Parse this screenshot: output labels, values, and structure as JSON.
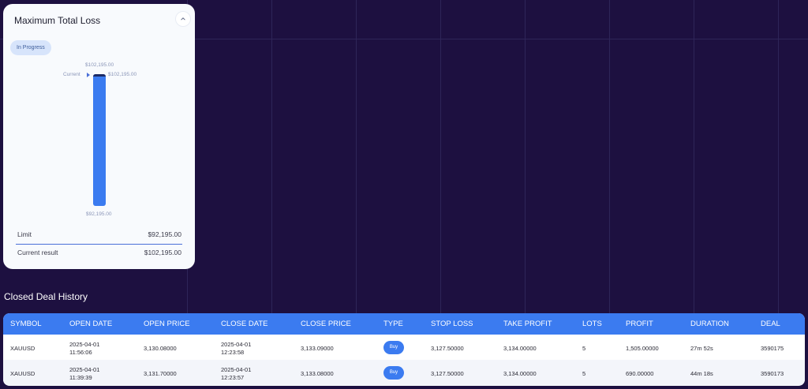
{
  "loss_card": {
    "title": "Maximum Total Loss",
    "status": "In Progress",
    "bar_top_value": "$102,195.00",
    "current_label": "Current",
    "current_value": "$102,195.00",
    "bar_bottom_value": "$92,195.00",
    "limit_label": "Limit",
    "limit_value": "$92,195.00",
    "current_result_label": "Current result",
    "current_result_value": "$102,195.00",
    "progress_fraction": 1.0
  },
  "history": {
    "title": "Closed Deal History",
    "columns": [
      "SYMBOL",
      "OPEN DATE",
      "OPEN PRICE",
      "CLOSE DATE",
      "CLOSE PRICE",
      "TYPE",
      "STOP LOSS",
      "TAKE PROFIT",
      "LOTS",
      "PROFIT",
      "DURATION",
      "DEAL"
    ],
    "rows": [
      {
        "symbol": "XAUUSD",
        "open_date": "2025-04-01",
        "open_time": "11:56:06",
        "open_price": "3,130.08000",
        "close_date": "2025-04-01",
        "close_time": "12:23:58",
        "close_price": "3,133.09000",
        "type": "Buy",
        "stop_loss": "3,127.50000",
        "take_profit": "3,134.00000",
        "lots": "5",
        "profit": "1,505.00000",
        "duration": "27m 52s",
        "deal": "3590175"
      },
      {
        "symbol": "XAUUSD",
        "open_date": "2025-04-01",
        "open_time": "11:39:39",
        "open_price": "3,131.70000",
        "close_date": "2025-04-01",
        "close_time": "12:23:57",
        "close_price": "3,133.08000",
        "type": "Buy",
        "stop_loss": "3,127.50000",
        "take_profit": "3,134.00000",
        "lots": "5",
        "profit": "690.00000",
        "duration": "44m 18s",
        "deal": "3590173"
      }
    ]
  }
}
